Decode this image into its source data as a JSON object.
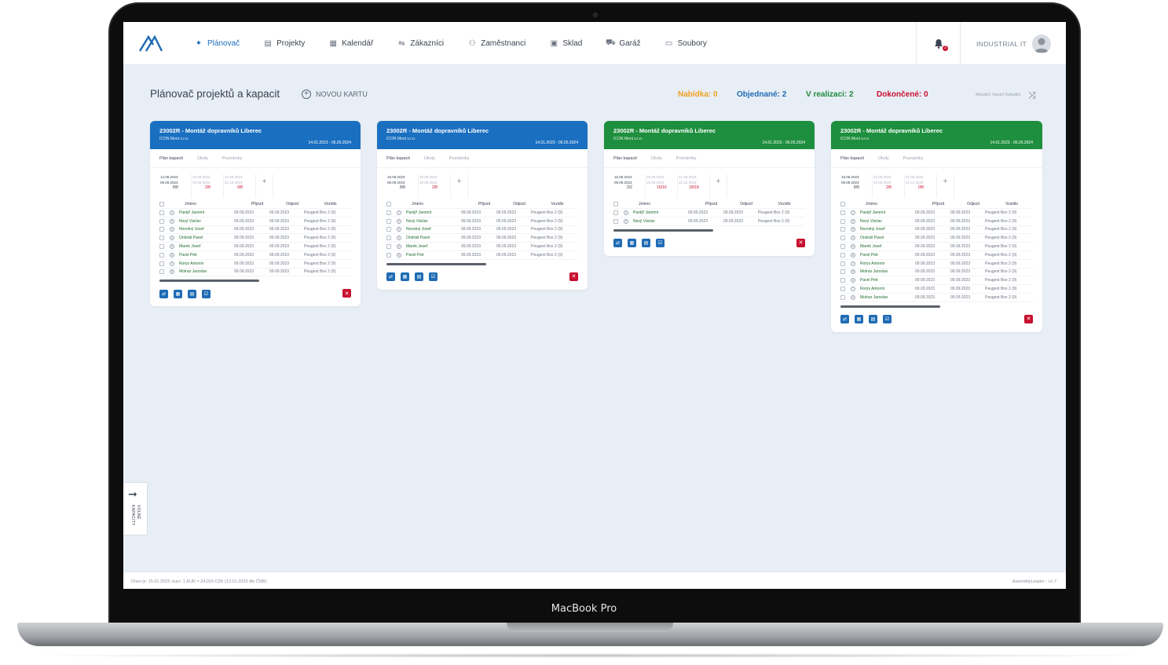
{
  "device_label": "MacBook Pro",
  "nav": {
    "items": [
      {
        "label": "Plánovač",
        "icon": "pin-icon",
        "active": true
      },
      {
        "label": "Projekty",
        "icon": "document-icon"
      },
      {
        "label": "Kalendář",
        "icon": "calendar-icon"
      },
      {
        "label": "Zákazníci",
        "icon": "handshake-icon"
      },
      {
        "label": "Zaměstnanci",
        "icon": "users-icon"
      },
      {
        "label": "Sklad",
        "icon": "boxes-icon"
      },
      {
        "label": "Garáž",
        "icon": "truck-icon"
      },
      {
        "label": "Soubory",
        "icon": "file-icon"
      }
    ],
    "notification_count": "2",
    "company": "INDUSTRIAL IT"
  },
  "header": {
    "title": "Plánovač projektů a kapacit",
    "new_card": "NOVOU KARTU",
    "filter_text": "Aktuální: Vlastní Defaultní",
    "status": {
      "offer": "Nabídka: 0",
      "ordered": "Objednané: 2",
      "in_progress": "V realizaci: 2",
      "done": "Dokončené: 0"
    },
    "colors": {
      "offer": "#f0a020",
      "ordered": "#1f6bb5",
      "in_progress": "#1e8a3a",
      "done": "#c8102e"
    }
  },
  "table_headers": {
    "name": "Jméno",
    "arrival": "Příjezd",
    "departure": "Odjezd",
    "vehicle": "Vozidlo"
  },
  "tabs": [
    "Plán kapacit",
    "Úkoly",
    "Poznámky"
  ],
  "cards": [
    {
      "color": "blue",
      "title": "23002R - Montáž dopravníků Liberec",
      "company": "ICON Mont s.r.o.",
      "dates": "14.01.2023 - 06.05.2024",
      "caps": [
        {
          "from": "14.06.2023",
          "to": "09.09.2023",
          "count": "8/8",
          "faded": false,
          "red": false
        },
        {
          "from": "10.09.2023",
          "to": "20.09.2023",
          "count": "2/8",
          "faded": true,
          "red": true
        },
        {
          "from": "21.09.2023",
          "to": "31.12.2023",
          "count": "0/8",
          "faded": true,
          "red": true
        }
      ],
      "rows": [
        {
          "n": "1",
          "name": "Pastýř Jaromír",
          "in": "09.09.2023",
          "out": "09.09.2023",
          "veh": "Peugeot Box 2 (9)"
        },
        {
          "n": "2",
          "name": "Nový Václav",
          "in": "09.09.2023",
          "out": "09.09.2023",
          "veh": "Peugeot Box 2 (9)"
        },
        {
          "n": "3",
          "name": "Novotný Josef",
          "in": "09.09.2023",
          "out": "09.09.2023",
          "veh": "Peugeot Box 2 (9)"
        },
        {
          "n": "4",
          "name": "Ondráš Pavel",
          "in": "09.09.2023",
          "out": "09.09.2023",
          "veh": "Peugeot Box 2 (9)"
        },
        {
          "n": "5",
          "name": "Marek Josef",
          "in": "09.09.2023",
          "out": "09.09.2023",
          "veh": "Peugeot Box 2 (9)"
        },
        {
          "n": "6",
          "name": "Pavel Petr",
          "in": "09.09.2023",
          "out": "09.09.2023",
          "veh": "Peugeot Box 2 (9)"
        },
        {
          "n": "7",
          "name": "Rorýs Antonín",
          "in": "09.09.2023",
          "out": "09.09.2023",
          "veh": "Peugeot Box 2 (9)"
        },
        {
          "n": "8",
          "name": "Molnar Jaroslav",
          "in": "09.09.2023",
          "out": "09.09.2023",
          "veh": "Peugeot Box 2 (9)"
        }
      ]
    },
    {
      "color": "blue",
      "title": "23002R - Montáž dopravníků Liberec",
      "company": "ICON Mont s.r.o.",
      "dates": "14.01.2023 - 06.05.2024",
      "caps": [
        {
          "from": "16.06.2023",
          "to": "09.09.2023",
          "count": "8/8",
          "faded": false,
          "red": false
        },
        {
          "from": "10.09.2023",
          "to": "20.09.2023",
          "count": "2/8",
          "faded": true,
          "red": true
        }
      ],
      "rows": [
        {
          "n": "1",
          "name": "Pastýř Jaromír",
          "in": "09.09.2023",
          "out": "09.09.2023",
          "veh": "Peugeot Box 2 (9)"
        },
        {
          "n": "2",
          "name": "Nový Václav",
          "in": "09.09.2023",
          "out": "09.09.2023",
          "veh": "Peugeot Box 2 (9)"
        },
        {
          "n": "3",
          "name": "Novotný Josef",
          "in": "09.09.2023",
          "out": "09.09.2023",
          "veh": "Peugeot Box 2 (9)"
        },
        {
          "n": "4",
          "name": "Ondráš Pavel",
          "in": "09.09.2023",
          "out": "09.09.2023",
          "veh": "Peugeot Box 2 (9)"
        },
        {
          "n": "5",
          "name": "Marek Josef",
          "in": "09.09.2023",
          "out": "09.09.2023",
          "veh": "Peugeot Box 2 (9)"
        },
        {
          "n": "6",
          "name": "Pavel Petr",
          "in": "09.09.2023",
          "out": "09.09.2023",
          "veh": "Peugeot Box 2 (9)"
        }
      ]
    },
    {
      "color": "green",
      "title": "23002R - Montáž dopravníků Liberec",
      "company": "ICON Mont s.r.o.",
      "dates": "14.01.2023 - 06.05.2024",
      "caps": [
        {
          "from": "16.06.2023",
          "to": "09.09.2023",
          "count": "2/2",
          "faded": false,
          "red": false
        },
        {
          "from": "10.09.2023",
          "to": "20.09.2023",
          "count": "16/16",
          "faded": true,
          "red": true
        },
        {
          "from": "21.09.2023",
          "to": "31.12.2023",
          "count": "18/18",
          "faded": true,
          "red": true
        }
      ],
      "rows": [
        {
          "n": "1",
          "name": "Pastýř Jaromír",
          "in": "09.09.2023",
          "out": "09.09.2023",
          "veh": "Peugeot Box 2 (9)"
        },
        {
          "n": "2",
          "name": "Nový Václav",
          "in": "09.09.2023",
          "out": "09.09.2023",
          "veh": "Peugeot Box 2 (9)"
        }
      ]
    },
    {
      "color": "green",
      "title": "23002R - Montáž dopravníků Liberec",
      "company": "ICON Mont s.r.o.",
      "dates": "14.01.2023 - 06.05.2024",
      "caps": [
        {
          "from": "16.06.2023",
          "to": "09.09.2023",
          "count": "8/8",
          "faded": false,
          "red": false
        },
        {
          "from": "10.09.2023",
          "to": "20.09.2023",
          "count": "2/8",
          "faded": true,
          "red": true
        },
        {
          "from": "21.09.2023",
          "to": "31.12.2023",
          "count": "0/8",
          "faded": true,
          "red": true
        }
      ],
      "rows": [
        {
          "n": "1",
          "name": "Pastýř Jaromír",
          "in": "09.09.2023",
          "out": "09.09.2023",
          "veh": "Peugeot Box 2 (9)"
        },
        {
          "n": "2",
          "name": "Nový Václav",
          "in": "09.09.2023",
          "out": "09.09.2023",
          "veh": "Peugeot Box 2 (9)"
        },
        {
          "n": "3",
          "name": "Novotný Josef",
          "in": "09.09.2023",
          "out": "09.09.2023",
          "veh": "Peugeot Box 2 (9)"
        },
        {
          "n": "4",
          "name": "Ondráš Pavel",
          "in": "09.09.2023",
          "out": "09.09.2023",
          "veh": "Peugeot Box 2 (9)"
        },
        {
          "n": "5",
          "name": "Marek Josef",
          "in": "09.09.2023",
          "out": "09.09.2023",
          "veh": "Peugeot Box 2 (9)"
        },
        {
          "n": "6",
          "name": "Pavel Petr",
          "in": "09.09.2023",
          "out": "09.09.2023",
          "veh": "Peugeot Box 2 (9)"
        },
        {
          "n": "7",
          "name": "Rorýs Antonín",
          "in": "09.09.2023",
          "out": "09.09.2023",
          "veh": "Peugeot Box 2 (9)"
        },
        {
          "n": "8",
          "name": "Molnar Jaroslav",
          "in": "09.09.2023",
          "out": "09.09.2023",
          "veh": "Peugeot Box 2 (9)"
        },
        {
          "n": "6",
          "name": "Pavel Petr",
          "in": "09.09.2023",
          "out": "09.09.2023",
          "veh": "Peugeot Box 2 (9)"
        },
        {
          "n": "7",
          "name": "Rorýs Antonín",
          "in": "09.09.2023",
          "out": "09.09.2023",
          "veh": "Peugeot Box 2 (9)"
        },
        {
          "n": "8",
          "name": "Molnar Jaroslav",
          "in": "09.09.2023",
          "out": "09.09.2023",
          "veh": "Peugeot Box 2 (9)"
        }
      ]
    }
  ],
  "side_tab": {
    "label": "VOLNÉ KAPACITY"
  },
  "footer": {
    "left": "Dnes je: 15.01.2023, kurz: 1 EUR = 24,015 CZK (13.01.2023 dle ČNB).",
    "right": "AssemblyLeader - v1.7"
  }
}
